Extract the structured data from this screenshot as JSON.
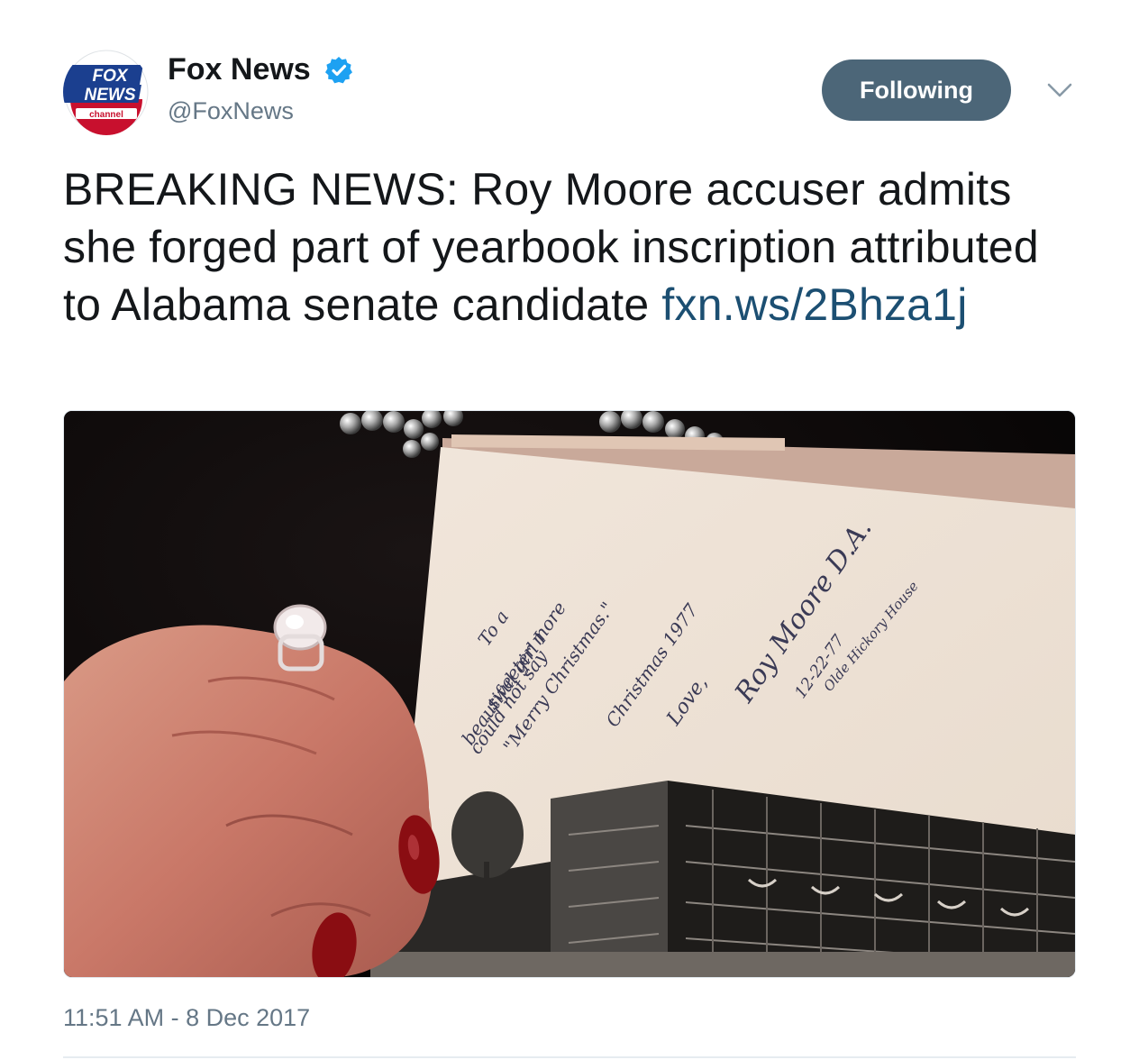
{
  "author": {
    "name": "Fox News",
    "handle": "@FoxNews",
    "verified": true,
    "avatar_icon": "fox-news-channel-logo"
  },
  "actions": {
    "follow_label": "Following",
    "menu_icon": "chevron-down-icon"
  },
  "tweet": {
    "text": "BREAKING NEWS: Roy Moore accuser admits she forged part of yearbook inscription attributed to Alabama senate candidate ",
    "link": "fxn.ws/2Bhza1j",
    "timestamp": "11:51 AM - 8 Dec 2017"
  },
  "media": {
    "handwriting_lines": [
      "To a",
      "sweeter more",
      "beautiful girl I",
      "could not say",
      "\"Merry Christmas.\"",
      "Christmas 1977",
      "Love,",
      "Roy Moore D.A.",
      "12-22-77",
      "Olde Hickory House"
    ]
  },
  "colors": {
    "accent_link": "#1c4f72",
    "follow_button": "#4c6678",
    "secondary_text": "#657786",
    "verified_badge": "#1da1f2"
  }
}
